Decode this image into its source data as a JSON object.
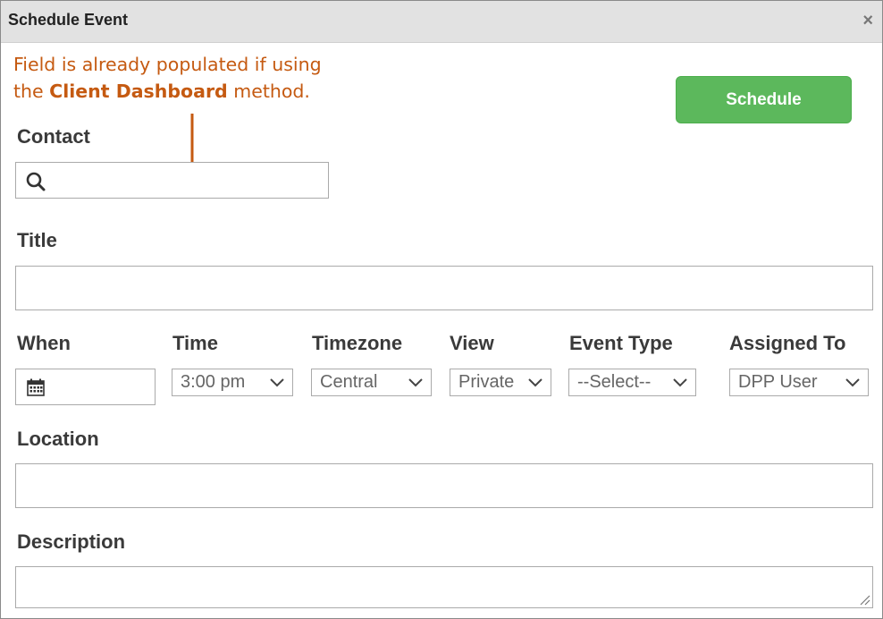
{
  "dialog": {
    "title": "Schedule Event",
    "close_symbol": "×"
  },
  "annotation": {
    "line1": "Field is already populated if using",
    "line2_prefix": "the ",
    "line2_bold": "Client Dashboard",
    "line2_suffix": " method."
  },
  "toolbar": {
    "schedule_label": "Schedule"
  },
  "form": {
    "contact_label": "Contact",
    "contact_value": "",
    "title_label": "Title",
    "title_value": "",
    "when_label": "When",
    "when_value": "",
    "time_label": "Time",
    "time_value": "3:00 pm",
    "timezone_label": "Timezone",
    "timezone_value": "Central",
    "view_label": "View",
    "view_value": "Private",
    "event_type_label": "Event Type",
    "event_type_value": "--Select--",
    "assigned_to_label": "Assigned To",
    "assigned_to_value": "DPP User",
    "location_label": "Location",
    "location_value": "",
    "description_label": "Description",
    "description_value": ""
  },
  "colors": {
    "accent_green": "#5cb85c",
    "annotation_orange": "#c55a11",
    "titlebar_gray": "#e2e2e2"
  },
  "icons": {
    "search": "search-icon",
    "calendar": "calendar-icon",
    "chevron": "chevron-down-icon",
    "close": "close-icon",
    "resize": "resize-handle-icon"
  }
}
